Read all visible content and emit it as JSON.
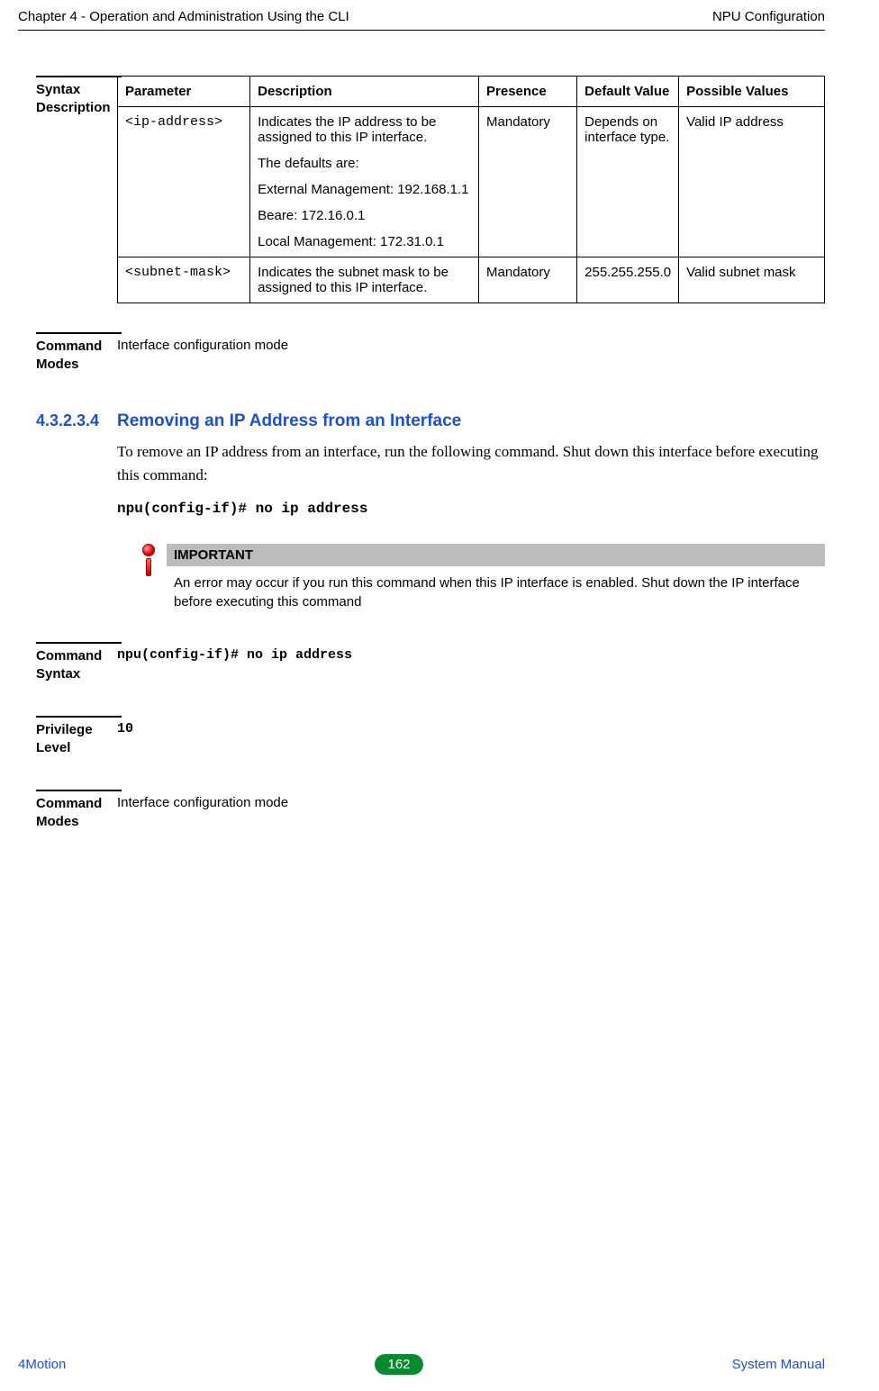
{
  "header": {
    "left": "Chapter 4 - Operation and Administration Using the CLI",
    "right": "NPU Configuration"
  },
  "syntax_desc": {
    "label": "Syntax Description",
    "headers": {
      "param": "Parameter",
      "desc": "Description",
      "pres": "Presence",
      "def": "Default Value",
      "poss": "Possible Values"
    },
    "rows": [
      {
        "param": "<ip-address>",
        "desc_p1": "Indicates the IP address to be assigned to this IP interface.",
        "desc_p2": "The defaults are:",
        "desc_p3": "External Management: 192.168.1.1",
        "desc_p4": "Beare: 172.16.0.1",
        "desc_p5": "Local Management: 172.31.0.1",
        "pres": "Mandatory",
        "def": "Depends on interface type.",
        "poss": "Valid IP address"
      },
      {
        "param": "<subnet-mask>",
        "desc": "Indicates the subnet mask to be assigned to this IP interface.",
        "pres": "Mandatory",
        "def": "255.255.255.0",
        "poss": "Valid subnet mask"
      }
    ]
  },
  "cmd_modes1": {
    "label": "Command Modes",
    "value": "Interface configuration mode"
  },
  "section": {
    "num": "4.3.2.3.4",
    "title": "Removing an IP Address from an Interface",
    "body": "To remove an IP address from an interface, run the following command. Shut down this interface before executing this command:",
    "cmd": "npu(config-if)# no ip address"
  },
  "important": {
    "head": "IMPORTANT",
    "body": "An error may occur if you run this command when this IP interface is enabled. Shut down the IP interface before executing this command"
  },
  "cmd_syntax": {
    "label": "Command Syntax",
    "value": "npu(config-if)# no ip address"
  },
  "priv_level": {
    "label": "Privilege Level",
    "value": "10"
  },
  "cmd_modes2": {
    "label": "Command Modes",
    "value": "Interface configuration mode"
  },
  "footer": {
    "left": "4Motion",
    "page": "162",
    "right": "System Manual"
  }
}
